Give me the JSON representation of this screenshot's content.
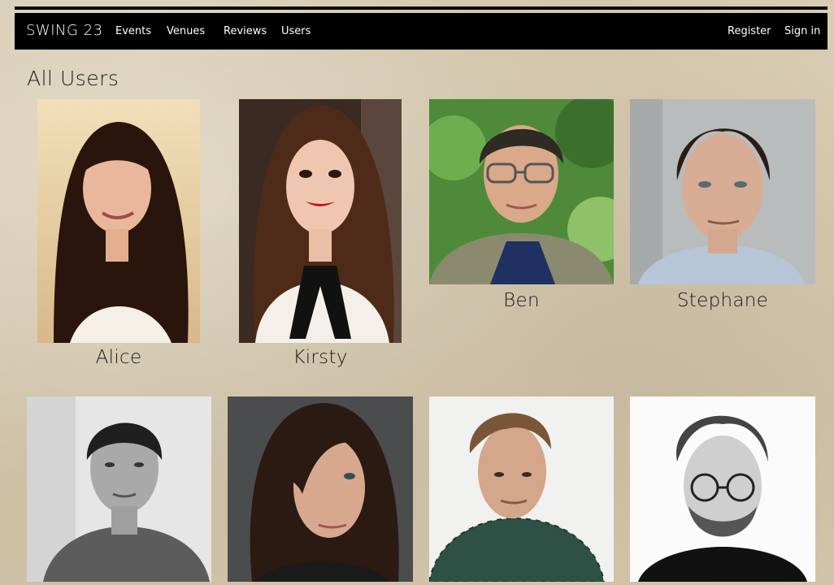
{
  "nav": {
    "brand": "SWING 23",
    "links": [
      "Events",
      "Venues",
      "Reviews",
      "Users"
    ],
    "right_links": [
      "Register",
      "Sign in"
    ]
  },
  "page": {
    "title": "All Users"
  },
  "users": [
    {
      "name": "Alice"
    },
    {
      "name": "Kirsty"
    },
    {
      "name": "Ben"
    },
    {
      "name": "Stephane"
    },
    {
      "name": ""
    },
    {
      "name": ""
    },
    {
      "name": ""
    },
    {
      "name": ""
    }
  ]
}
